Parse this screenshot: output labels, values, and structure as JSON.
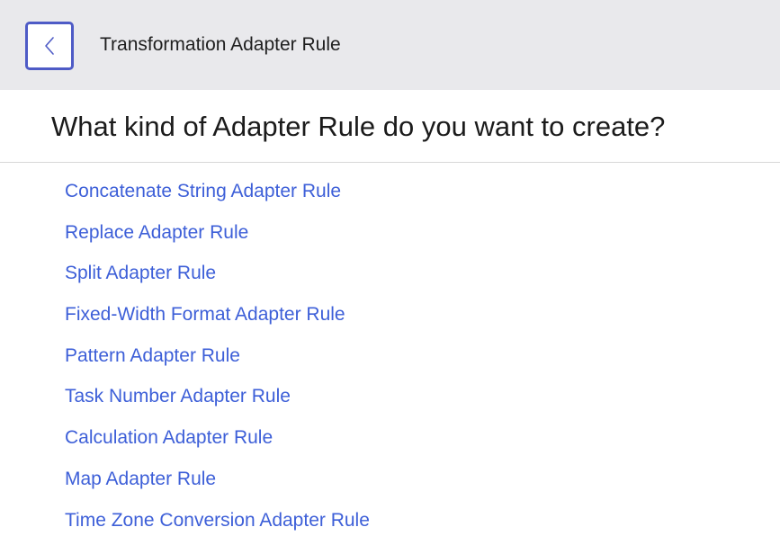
{
  "header": {
    "back_icon": "chevron-left-icon",
    "title": "Transformation Adapter Rule"
  },
  "question": "What kind of Adapter Rule do you want to create?",
  "colors": {
    "header_bg": "#e9e9ec",
    "back_border": "#4e5bc6",
    "link": "#3d5fd8"
  },
  "rule_types": [
    "Concatenate String Adapter Rule",
    "Replace Adapter Rule",
    "Split Adapter Rule",
    "Fixed-Width Format Adapter Rule",
    "Pattern Adapter Rule",
    "Task Number Adapter Rule",
    "Calculation Adapter Rule",
    "Map Adapter Rule",
    "Time Zone Conversion Adapter Rule"
  ]
}
